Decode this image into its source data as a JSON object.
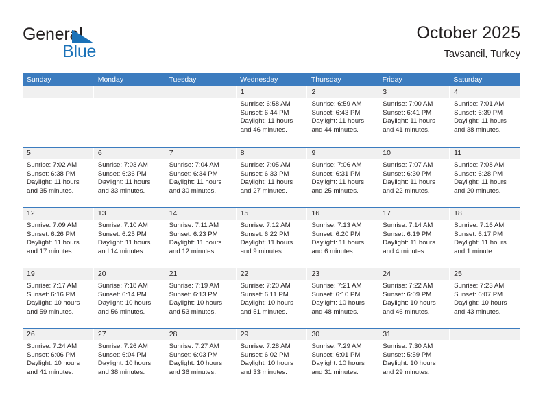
{
  "brand": {
    "name_part1": "General",
    "name_part2": "Blue",
    "accent_color": "#1b72b8"
  },
  "header": {
    "title": "October 2025",
    "subtitle": "Tavsancil, Turkey"
  },
  "calendar": {
    "header_color": "#3c7cbf",
    "weekdays": [
      "Sunday",
      "Monday",
      "Tuesday",
      "Wednesday",
      "Thursday",
      "Friday",
      "Saturday"
    ],
    "weeks": [
      [
        {
          "day": "",
          "sunrise": "",
          "sunset": "",
          "daylight": "",
          "empty": true
        },
        {
          "day": "",
          "sunrise": "",
          "sunset": "",
          "daylight": "",
          "empty": true
        },
        {
          "day": "",
          "sunrise": "",
          "sunset": "",
          "daylight": "",
          "empty": true
        },
        {
          "day": "1",
          "sunrise": "Sunrise: 6:58 AM",
          "sunset": "Sunset: 6:44 PM",
          "daylight": "Daylight: 11 hours and 46 minutes."
        },
        {
          "day": "2",
          "sunrise": "Sunrise: 6:59 AM",
          "sunset": "Sunset: 6:43 PM",
          "daylight": "Daylight: 11 hours and 44 minutes."
        },
        {
          "day": "3",
          "sunrise": "Sunrise: 7:00 AM",
          "sunset": "Sunset: 6:41 PM",
          "daylight": "Daylight: 11 hours and 41 minutes."
        },
        {
          "day": "4",
          "sunrise": "Sunrise: 7:01 AM",
          "sunset": "Sunset: 6:39 PM",
          "daylight": "Daylight: 11 hours and 38 minutes."
        }
      ],
      [
        {
          "day": "5",
          "sunrise": "Sunrise: 7:02 AM",
          "sunset": "Sunset: 6:38 PM",
          "daylight": "Daylight: 11 hours and 35 minutes."
        },
        {
          "day": "6",
          "sunrise": "Sunrise: 7:03 AM",
          "sunset": "Sunset: 6:36 PM",
          "daylight": "Daylight: 11 hours and 33 minutes."
        },
        {
          "day": "7",
          "sunrise": "Sunrise: 7:04 AM",
          "sunset": "Sunset: 6:34 PM",
          "daylight": "Daylight: 11 hours and 30 minutes."
        },
        {
          "day": "8",
          "sunrise": "Sunrise: 7:05 AM",
          "sunset": "Sunset: 6:33 PM",
          "daylight": "Daylight: 11 hours and 27 minutes."
        },
        {
          "day": "9",
          "sunrise": "Sunrise: 7:06 AM",
          "sunset": "Sunset: 6:31 PM",
          "daylight": "Daylight: 11 hours and 25 minutes."
        },
        {
          "day": "10",
          "sunrise": "Sunrise: 7:07 AM",
          "sunset": "Sunset: 6:30 PM",
          "daylight": "Daylight: 11 hours and 22 minutes."
        },
        {
          "day": "11",
          "sunrise": "Sunrise: 7:08 AM",
          "sunset": "Sunset: 6:28 PM",
          "daylight": "Daylight: 11 hours and 20 minutes."
        }
      ],
      [
        {
          "day": "12",
          "sunrise": "Sunrise: 7:09 AM",
          "sunset": "Sunset: 6:26 PM",
          "daylight": "Daylight: 11 hours and 17 minutes."
        },
        {
          "day": "13",
          "sunrise": "Sunrise: 7:10 AM",
          "sunset": "Sunset: 6:25 PM",
          "daylight": "Daylight: 11 hours and 14 minutes."
        },
        {
          "day": "14",
          "sunrise": "Sunrise: 7:11 AM",
          "sunset": "Sunset: 6:23 PM",
          "daylight": "Daylight: 11 hours and 12 minutes."
        },
        {
          "day": "15",
          "sunrise": "Sunrise: 7:12 AM",
          "sunset": "Sunset: 6:22 PM",
          "daylight": "Daylight: 11 hours and 9 minutes."
        },
        {
          "day": "16",
          "sunrise": "Sunrise: 7:13 AM",
          "sunset": "Sunset: 6:20 PM",
          "daylight": "Daylight: 11 hours and 6 minutes."
        },
        {
          "day": "17",
          "sunrise": "Sunrise: 7:14 AM",
          "sunset": "Sunset: 6:19 PM",
          "daylight": "Daylight: 11 hours and 4 minutes."
        },
        {
          "day": "18",
          "sunrise": "Sunrise: 7:16 AM",
          "sunset": "Sunset: 6:17 PM",
          "daylight": "Daylight: 11 hours and 1 minute."
        }
      ],
      [
        {
          "day": "19",
          "sunrise": "Sunrise: 7:17 AM",
          "sunset": "Sunset: 6:16 PM",
          "daylight": "Daylight: 10 hours and 59 minutes."
        },
        {
          "day": "20",
          "sunrise": "Sunrise: 7:18 AM",
          "sunset": "Sunset: 6:14 PM",
          "daylight": "Daylight: 10 hours and 56 minutes."
        },
        {
          "day": "21",
          "sunrise": "Sunrise: 7:19 AM",
          "sunset": "Sunset: 6:13 PM",
          "daylight": "Daylight: 10 hours and 53 minutes."
        },
        {
          "day": "22",
          "sunrise": "Sunrise: 7:20 AM",
          "sunset": "Sunset: 6:11 PM",
          "daylight": "Daylight: 10 hours and 51 minutes."
        },
        {
          "day": "23",
          "sunrise": "Sunrise: 7:21 AM",
          "sunset": "Sunset: 6:10 PM",
          "daylight": "Daylight: 10 hours and 48 minutes."
        },
        {
          "day": "24",
          "sunrise": "Sunrise: 7:22 AM",
          "sunset": "Sunset: 6:09 PM",
          "daylight": "Daylight: 10 hours and 46 minutes."
        },
        {
          "day": "25",
          "sunrise": "Sunrise: 7:23 AM",
          "sunset": "Sunset: 6:07 PM",
          "daylight": "Daylight: 10 hours and 43 minutes."
        }
      ],
      [
        {
          "day": "26",
          "sunrise": "Sunrise: 7:24 AM",
          "sunset": "Sunset: 6:06 PM",
          "daylight": "Daylight: 10 hours and 41 minutes."
        },
        {
          "day": "27",
          "sunrise": "Sunrise: 7:26 AM",
          "sunset": "Sunset: 6:04 PM",
          "daylight": "Daylight: 10 hours and 38 minutes."
        },
        {
          "day": "28",
          "sunrise": "Sunrise: 7:27 AM",
          "sunset": "Sunset: 6:03 PM",
          "daylight": "Daylight: 10 hours and 36 minutes."
        },
        {
          "day": "29",
          "sunrise": "Sunrise: 7:28 AM",
          "sunset": "Sunset: 6:02 PM",
          "daylight": "Daylight: 10 hours and 33 minutes."
        },
        {
          "day": "30",
          "sunrise": "Sunrise: 7:29 AM",
          "sunset": "Sunset: 6:01 PM",
          "daylight": "Daylight: 10 hours and 31 minutes."
        },
        {
          "day": "31",
          "sunrise": "Sunrise: 7:30 AM",
          "sunset": "Sunset: 5:59 PM",
          "daylight": "Daylight: 10 hours and 29 minutes."
        },
        {
          "day": "",
          "sunrise": "",
          "sunset": "",
          "daylight": "",
          "empty": true
        }
      ]
    ]
  }
}
